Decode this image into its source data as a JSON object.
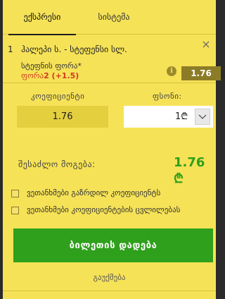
{
  "tabs": [
    {
      "label": "ექსპრესი",
      "active": true
    },
    {
      "label": "სისტემა",
      "active": false
    }
  ],
  "bet": {
    "index": "1",
    "title": "ჰალეპი ს. - სტეფენსი სლ.",
    "market": "სტეფნის ფორა*",
    "handicap_label": "ფორა",
    "handicap_value": "2 (+1.5)",
    "odds": "1.76",
    "info_icon": "ℹ"
  },
  "coefficient": {
    "label": "კოეფიციენტი",
    "value": "1.76"
  },
  "stake": {
    "label": "ფსონი:",
    "value": "1₾"
  },
  "possible_win": {
    "label": "შესაძლო მოგება:",
    "value": "1.76 ₾"
  },
  "options": [
    {
      "label": "ვეთანხმები გაზრდილ კოეფიციენტს",
      "checked": false
    },
    {
      "label": "ვეთანხმები კოეფიციენტების ცვლილებას",
      "checked": false
    }
  ],
  "actions": {
    "place_bet": "ბილეთის დადება",
    "cancel": "გაუქმება"
  },
  "colors": {
    "panel_bg": "#f6e257",
    "accent_green": "#2ea01b",
    "odds_badge": "#8c7c26",
    "handicap_red": "#d23a1e"
  }
}
